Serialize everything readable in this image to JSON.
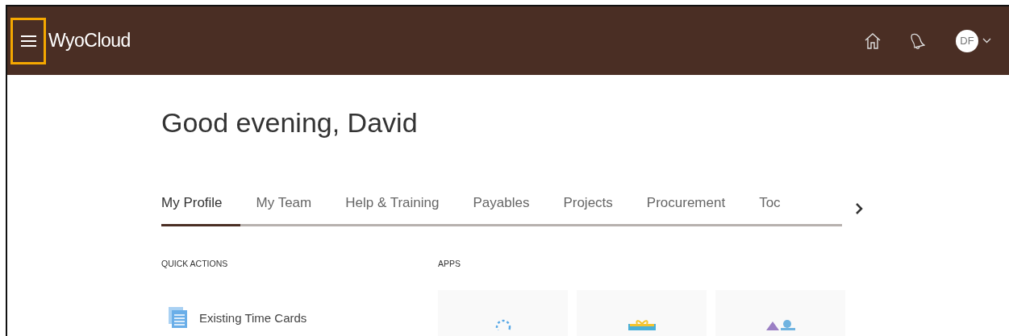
{
  "header": {
    "logo": "WyoCloud",
    "avatar": "DF"
  },
  "greeting": "Good evening, David",
  "tabs": [
    {
      "label": "My Profile",
      "selected": true
    },
    {
      "label": "My Team",
      "selected": false
    },
    {
      "label": "Help & Training",
      "selected": false
    },
    {
      "label": "Payables",
      "selected": false
    },
    {
      "label": "Projects",
      "selected": false
    },
    {
      "label": "Procurement",
      "selected": false
    },
    {
      "label": "Toc",
      "selected": false
    }
  ],
  "quick_actions": {
    "title": "QUICK ACTIONS",
    "items": [
      "Existing Time Cards"
    ]
  },
  "apps": {
    "title": "APPS",
    "tiles": [
      {
        "kind": "ring"
      },
      {
        "kind": "gift"
      },
      {
        "kind": "people"
      }
    ]
  }
}
